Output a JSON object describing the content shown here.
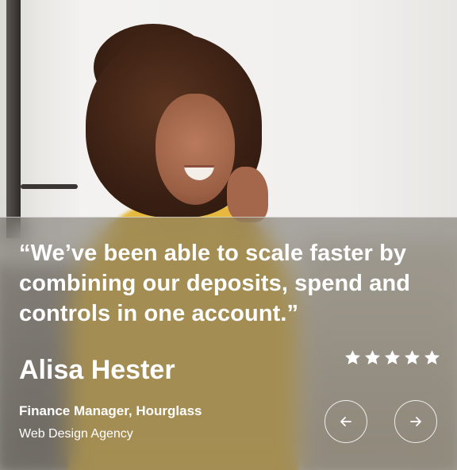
{
  "testimonial": {
    "quote": "“We’ve been able to scale faster by combining our deposits, spend and controls in one account.”",
    "author_name": "Alisa Hester",
    "author_role": "Finance Manager, Hourglass",
    "author_company": "Web Design Agency",
    "rating": 5,
    "rating_max": 5
  },
  "navigation": {
    "previous_icon": "arrow-left-icon",
    "next_icon": "arrow-right-icon"
  },
  "colors": {
    "text": "#ffffff",
    "overlay": "#6e6962"
  }
}
